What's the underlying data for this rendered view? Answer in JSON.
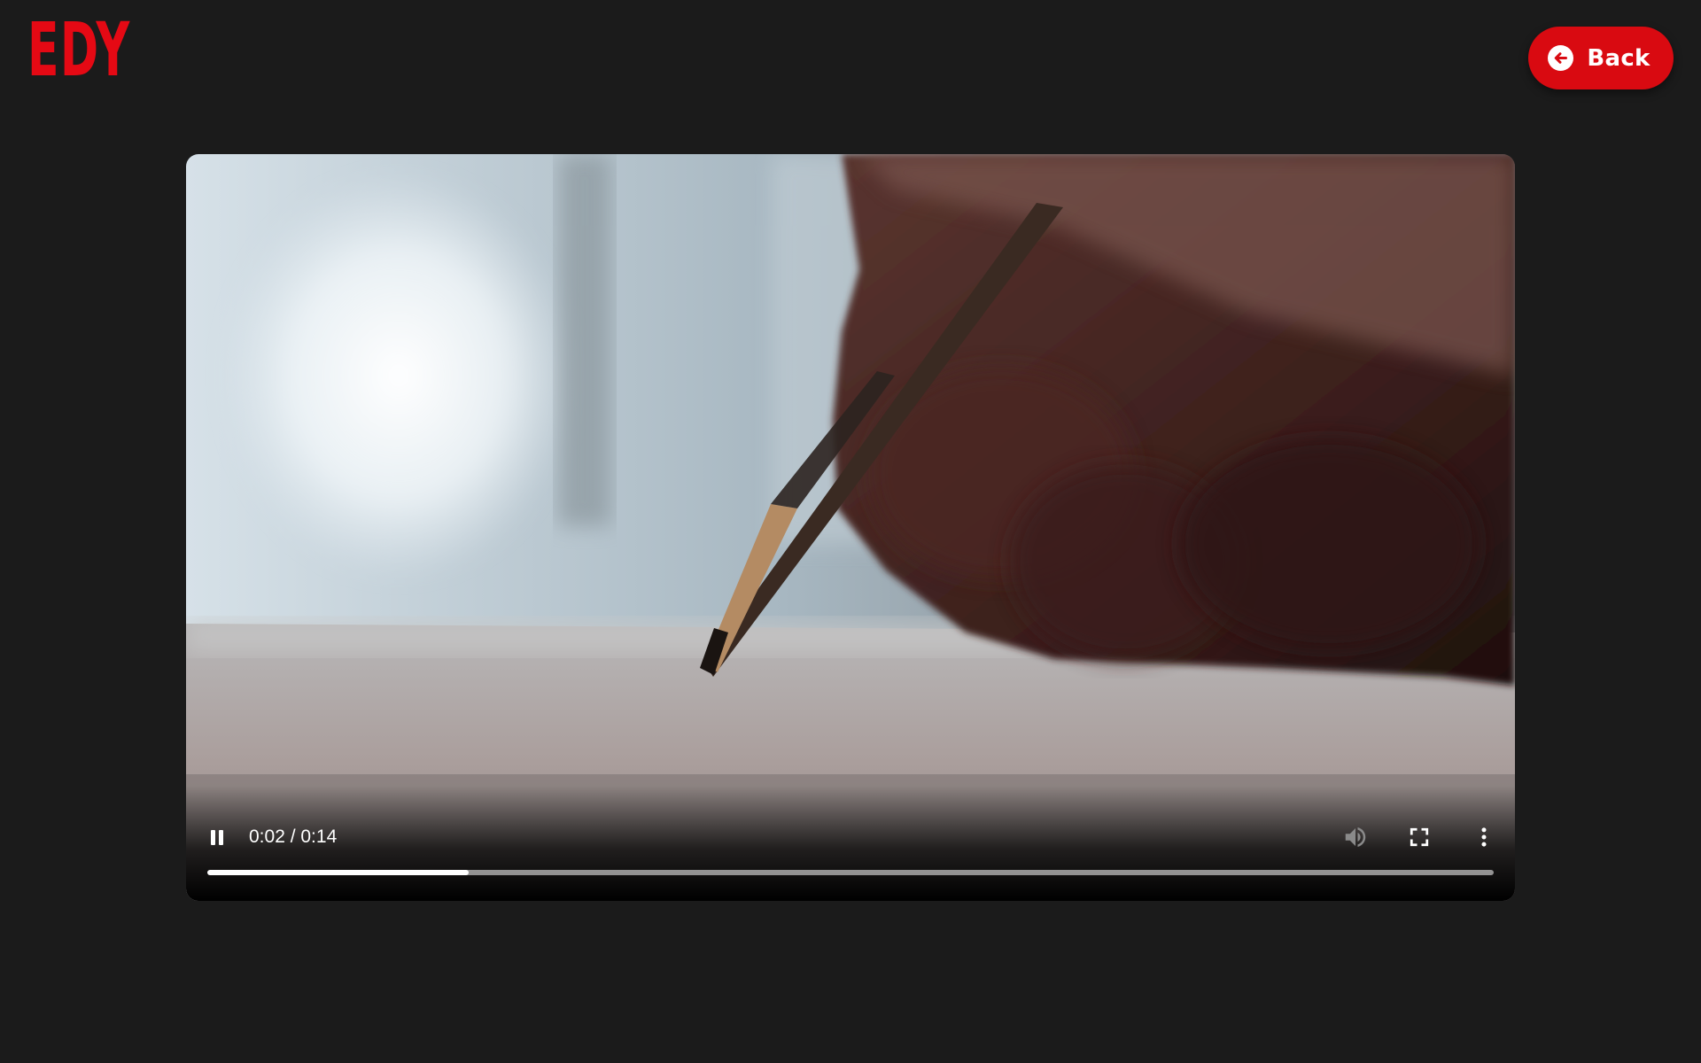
{
  "header": {
    "logo_text": "EDY",
    "back_label": "Back"
  },
  "video": {
    "time_display": "0:02 / 0:14",
    "current_time": "0:02",
    "duration": "0:14",
    "progress_fraction": 0.203,
    "state": "playing"
  },
  "icons": {
    "back": "arrow-left-circle-icon",
    "play_pause": "pause-icon",
    "mute": "volume-icon",
    "fullscreen": "fullscreen-icon",
    "more": "more-vertical-icon"
  },
  "colors": {
    "brand": "#e50914",
    "button": "#d90a11",
    "background": "#1b1b1b"
  }
}
